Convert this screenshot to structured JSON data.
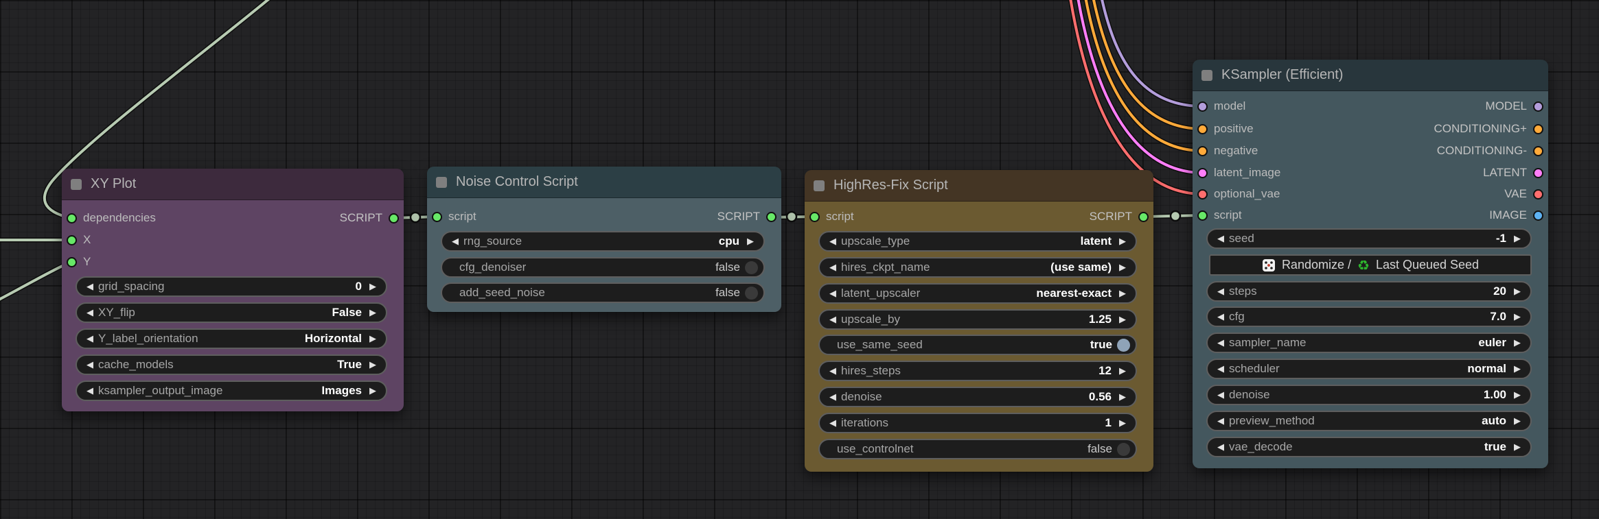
{
  "glyphs": {
    "left_arrow": "◀",
    "right_arrow": "▶",
    "recycle": "♻"
  },
  "wire_colors": {
    "script": "#b7cbb2",
    "model": "#b39ddb",
    "conditioning": "#ffaa3a",
    "latent": "#ff7ef9",
    "vae": "#ff6e6e"
  },
  "nodes": [
    {
      "title": "XY Plot",
      "header_color": "#3d2a3d",
      "body_color": "#5e4463",
      "inputs": [
        {
          "label": "dependencies",
          "color": "#67e867"
        },
        {
          "label": "X",
          "color": "#67e867"
        },
        {
          "label": "Y",
          "color": "#67e867"
        }
      ],
      "outputs": [
        {
          "label": "SCRIPT",
          "color": "#67e867"
        }
      ],
      "widgets": [
        {
          "type": "combo",
          "label": "grid_spacing",
          "value": "0"
        },
        {
          "type": "combo",
          "label": "XY_flip",
          "value": "False"
        },
        {
          "type": "combo",
          "label": "Y_label_orientation",
          "value": "Horizontal"
        },
        {
          "type": "combo",
          "label": "cache_models",
          "value": "True"
        },
        {
          "type": "combo",
          "label": "ksampler_output_image",
          "value": "Images"
        }
      ]
    },
    {
      "title": "Noise Control Script",
      "header_color": "#2c3f45",
      "body_color": "#4d5f66",
      "inputs": [
        {
          "label": "script",
          "color": "#67e867"
        }
      ],
      "outputs": [
        {
          "label": "SCRIPT",
          "color": "#67e867"
        }
      ],
      "widgets": [
        {
          "type": "combo",
          "label": "rng_source",
          "value": "cpu"
        },
        {
          "type": "toggle",
          "label": "cfg_denoiser",
          "value": "false",
          "state": "off"
        },
        {
          "type": "toggle",
          "label": "add_seed_noise",
          "value": "false",
          "state": "off"
        }
      ]
    },
    {
      "title": "HighRes-Fix Script",
      "header_color": "#443524",
      "body_color": "#6b5a31",
      "inputs": [
        {
          "label": "script",
          "color": "#67e867"
        }
      ],
      "outputs": [
        {
          "label": "SCRIPT",
          "color": "#67e867"
        }
      ],
      "widgets": [
        {
          "type": "combo",
          "label": "upscale_type",
          "value": "latent"
        },
        {
          "type": "combo",
          "label": "hires_ckpt_name",
          "value": "(use same)"
        },
        {
          "type": "combo",
          "label": "latent_upscaler",
          "value": "nearest-exact"
        },
        {
          "type": "combo",
          "label": "upscale_by",
          "value": "1.25"
        },
        {
          "type": "toggle",
          "label": "use_same_seed",
          "value": "true",
          "state": "on"
        },
        {
          "type": "combo",
          "label": "hires_steps",
          "value": "12"
        },
        {
          "type": "combo",
          "label": "denoise",
          "value": "0.56"
        },
        {
          "type": "combo",
          "label": "iterations",
          "value": "1"
        },
        {
          "type": "toggle",
          "label": "use_controlnet",
          "value": "false",
          "state": "off"
        }
      ]
    },
    {
      "title": "KSampler (Efficient)",
      "header_color": "#28363c",
      "body_color": "#44575e",
      "inputs": [
        {
          "label": "model",
          "color": "#b39ddb"
        },
        {
          "label": "positive",
          "color": "#ffaa3a"
        },
        {
          "label": "negative",
          "color": "#ffaa3a"
        },
        {
          "label": "latent_image",
          "color": "#ff7ef9"
        },
        {
          "label": "optional_vae",
          "color": "#ff6e6e"
        },
        {
          "label": "script",
          "color": "#67e867"
        }
      ],
      "outputs": [
        {
          "label": "MODEL",
          "color": "#b39ddb"
        },
        {
          "label": "CONDITIONING+",
          "color": "#ffaa3a"
        },
        {
          "label": "CONDITIONING-",
          "color": "#ffaa3a"
        },
        {
          "label": "LATENT",
          "color": "#ff7ef9"
        },
        {
          "label": "VAE",
          "color": "#ff6e6e"
        },
        {
          "label": "IMAGE",
          "color": "#5db2f2"
        }
      ],
      "seed_button": {
        "randomize": "Randomize /",
        "last_seed": "Last Queued Seed"
      },
      "widgets": [
        {
          "type": "combo",
          "label": "seed",
          "value": "-1"
        },
        {
          "type": "combo",
          "label": "steps",
          "value": "20"
        },
        {
          "type": "combo",
          "label": "cfg",
          "value": "7.0"
        },
        {
          "type": "combo",
          "label": "sampler_name",
          "value": "euler"
        },
        {
          "type": "combo",
          "label": "scheduler",
          "value": "normal"
        },
        {
          "type": "combo",
          "label": "denoise",
          "value": "1.00"
        },
        {
          "type": "combo",
          "label": "preview_method",
          "value": "auto"
        },
        {
          "type": "combo",
          "label": "vae_decode",
          "value": "true"
        }
      ]
    }
  ]
}
